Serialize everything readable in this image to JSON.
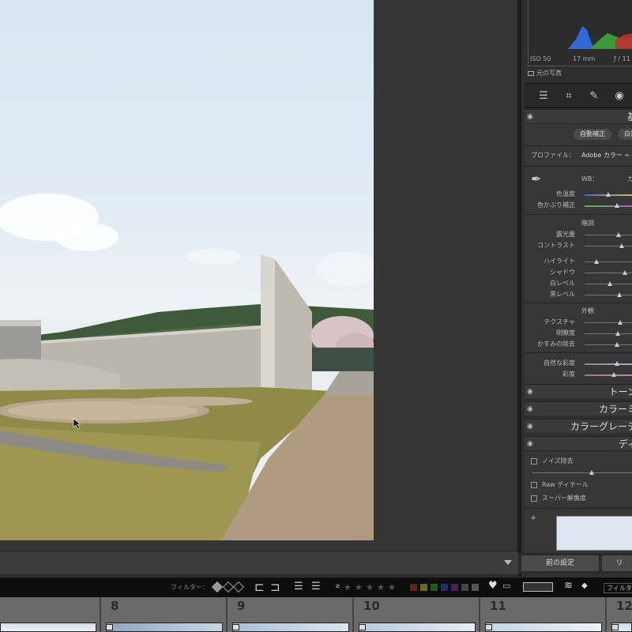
{
  "histogram": {
    "iso": "ISO 50",
    "focal": "17 mm",
    "aperture": "ƒ / 11",
    "original_label": "元の写真"
  },
  "basic_panel": {
    "title": "基",
    "auto_button": "自動補正",
    "auto_button2": "白黒",
    "profile_label": "プロファイル：",
    "profile_value": "Adobe カラー ÷",
    "wb_label": "WB：",
    "wb_value": "カ",
    "temp_label": "色温度",
    "tint_label": "色かぶり補正",
    "tone_group": "階調",
    "exposure_label": "露光量",
    "contrast_label": "コントラスト",
    "highlights_label": "ハイライト",
    "shadows_label": "シャドウ",
    "whites_label": "白レベル",
    "blacks_label": "黒レベル",
    "presence_group": "外観",
    "texture_label": "テクスチャ",
    "clarity_label": "明瞭度",
    "dehaze_label": "かすみの除去",
    "vibrance_label": "自然な彩度",
    "saturation_label": "彩度"
  },
  "sections": {
    "tone": "トーン",
    "color_mixer": "カラーミ",
    "color_grading": "カラーグレーデ",
    "detail": "ディ"
  },
  "detail_panel": {
    "noise": "ノイズ除去",
    "raw_detail": "Raw ディテール",
    "super_res": "スーパー解像度"
  },
  "bottom_buttons": {
    "previous": "前の設定",
    "reset": "リ"
  },
  "filter_bar": {
    "filter_label": "フィルター：",
    "filter_right": "フィルタ"
  },
  "filmstrip": {
    "frames": [
      "8",
      "9",
      "10",
      "11",
      "12"
    ]
  },
  "colors": {
    "accent": "#3a3a3a",
    "panel": "#2f2f2f"
  }
}
